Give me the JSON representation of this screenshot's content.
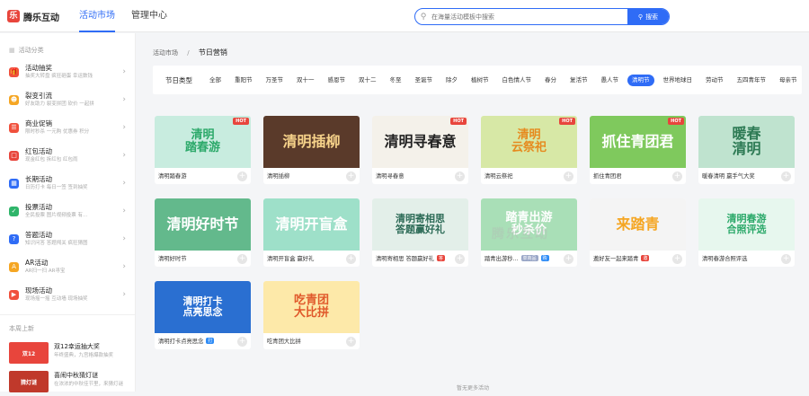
{
  "brand": {
    "logo_text": "腾乐互动"
  },
  "nav": [
    {
      "label": "活动市场",
      "active": true
    },
    {
      "label": "管理中心",
      "active": false
    }
  ],
  "search": {
    "placeholder": "在海量活动模板中搜索",
    "button": "搜索"
  },
  "sidebar": {
    "header": "活动分类",
    "items": [
      {
        "title": "活动抽奖",
        "sub": "抽奖大转盘  疯狂砸蛋  幸运数钱",
        "icon": "gift-icon",
        "color": "#f0503c"
      },
      {
        "title": "裂变引流",
        "sub": "好友助力  裂变拼团  砍价  一起拼",
        "icon": "user-icon",
        "color": "#f5a623"
      },
      {
        "title": "商业促销",
        "sub": "限时秒杀  一元购  优惠券  积分",
        "icon": "shop-icon",
        "color": "#f0503c"
      },
      {
        "title": "红包活动",
        "sub": "现金红包  拆红包  红包雨",
        "icon": "redpacket-icon",
        "color": "#e8453c"
      },
      {
        "title": "长期活动",
        "sub": "日历打卡  每日一签  签到抽奖",
        "icon": "calendar-icon",
        "color": "#2f6cf6"
      },
      {
        "title": "投票活动",
        "sub": "全民投票  图片视频投票  有...",
        "icon": "vote-icon",
        "color": "#2fb56a"
      },
      {
        "title": "答题活动",
        "sub": "知识问答  答题闯关  疯狂猜图",
        "icon": "quiz-icon",
        "color": "#2f6cf6"
      },
      {
        "title": "AR活动",
        "sub": "AR扫一扫  AR寻宝",
        "icon": "ar-icon",
        "color": "#f5a623"
      },
      {
        "title": "现场活动",
        "sub": "现场摇一摇  互动墙  现场抽奖",
        "icon": "live-icon",
        "color": "#f0503c"
      }
    ],
    "recent_header": "本周上新",
    "recent": [
      {
        "title": "双12幸运抽大奖",
        "sub": "年终盛典，九宫格爆款抽奖",
        "thumb_text": "双12",
        "color": "#e8453c"
      },
      {
        "title": "喜闹中秋猜灯谜",
        "sub": "在浓浓的中秋佳节里，来猜灯谜",
        "thumb_text": "猜灯谜",
        "color": "#c0392b"
      }
    ]
  },
  "breadcrumb": {
    "parent": "活动市场",
    "current": "节日营销"
  },
  "filter": {
    "label": "节日类型",
    "tags": [
      "全部",
      "重阳节",
      "万圣节",
      "双十一",
      "感恩节",
      "双十二",
      "冬至",
      "圣诞节",
      "除夕",
      "植树节",
      "白色情人节",
      "春分",
      "复活节",
      "愚人节",
      "清明节",
      "世界地球日",
      "劳动节",
      "五四青年节",
      "母亲节"
    ],
    "active_tag": "清明节"
  },
  "cards": [
    {
      "caption": "清明踏春游",
      "title_art": "清明\n踏春游",
      "hot": true,
      "bg": "#c8ecdf",
      "fg": "#2ca96a"
    },
    {
      "caption": "清明插柳",
      "title_art": "清明插柳",
      "hot": false,
      "bg": "#5a3a2a",
      "fg": "#f6d28a"
    },
    {
      "caption": "清明寻春意",
      "title_art": "清明寻春意",
      "hot": true,
      "bg": "#f4f1ea",
      "fg": "#222222"
    },
    {
      "caption": "清明云祭祀",
      "title_art": "清明\n云祭祀",
      "hot": true,
      "bg": "#d7e8a6",
      "fg": "#e68a1e"
    },
    {
      "caption": "抓住青团君",
      "title_art": "抓住青团君",
      "hot": true,
      "bg": "#7fc95d",
      "fg": "#ffffff"
    },
    {
      "caption": "暖春清明 赢手气大奖",
      "title_art": "暖春\n清明",
      "hot": false,
      "bg": "#bfe3cf",
      "fg": "#2d7a54"
    },
    {
      "caption": "清明好时节",
      "title_art": "清明好时节",
      "hot": false,
      "bg": "#63b98c",
      "fg": "#ffffff"
    },
    {
      "caption": "清明开盲盒 赢好礼",
      "title_art": "清明开盲盒",
      "hot": false,
      "bg": "#9ee0c9",
      "fg": "#ffffff"
    },
    {
      "caption": "清明寄相思 答题赢好礼",
      "title_art": "清明寄相思\n答题赢好礼",
      "hot": false,
      "bg": "#e3efe9",
      "fg": "#2d6b57",
      "badge": "答",
      "badge_color": "#e8453c"
    },
    {
      "caption": "踏青出游秒...",
      "title_art": "踏青出游\n秒杀价",
      "hot": false,
      "bg": "#a9dfb7",
      "fg": "#ffffff",
      "badge": "单商品",
      "badge_color": "#9aa7c7",
      "badge2": "购",
      "badge2_color": "#2f8cf6"
    },
    {
      "caption": "邀好友一起来踏青",
      "title_art": "来踏青",
      "hot": false,
      "bg": "#f4f4f4",
      "fg": "#f5a623",
      "badge": "邀",
      "badge_color": "#e8453c"
    },
    {
      "caption": "清明春游合照评选",
      "title_art": "清明春游\n合照评选",
      "hot": false,
      "bg": "#e7f7ee",
      "fg": "#2ca96a"
    },
    {
      "caption": "清明打卡点亮思念",
      "title_art": "清明打卡\n点亮思念",
      "hot": false,
      "bg": "#2a6fd1",
      "fg": "#ffffff",
      "badge": "打",
      "badge_color": "#2f8cf6"
    },
    {
      "caption": "吃青团大比拼",
      "title_art": "吃青团\n大比拼",
      "hot": false,
      "bg": "#fde9a9",
      "fg": "#e0582a"
    }
  ],
  "footer": {
    "end_text": "暂无更多活动"
  },
  "watermark": "腾乐互动"
}
